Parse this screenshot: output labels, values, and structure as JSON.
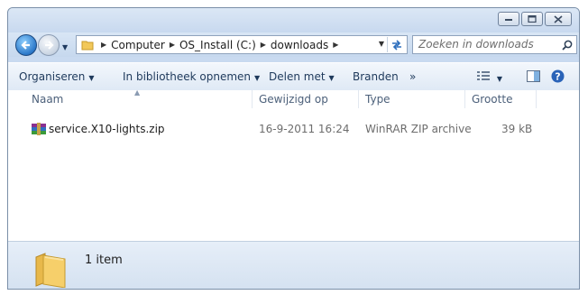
{
  "window": {
    "minimize_icon": "minimize-icon",
    "maximize_icon": "maximize-icon",
    "close_icon": "close-icon"
  },
  "address": {
    "crumbs": [
      "Computer",
      "OS_Install (C:)",
      "downloads"
    ]
  },
  "search": {
    "placeholder": "Zoeken in downloads"
  },
  "toolbar": {
    "organize": "Organiseren",
    "library": "In bibliotheek opnemen",
    "share": "Delen met",
    "burn": "Branden",
    "more": "»"
  },
  "columns": {
    "name": "Naam",
    "modified": "Gewijzigd op",
    "type": "Type",
    "size": "Grootte"
  },
  "files": [
    {
      "name": "service.X10-lights.zip",
      "modified": "16-9-2011 16:24",
      "type": "WinRAR ZIP archive",
      "size": "39 kB"
    }
  ],
  "status": {
    "count": "1 item"
  },
  "colors": {
    "accent": "#1e395b",
    "window_frame": "#c9daf0"
  }
}
